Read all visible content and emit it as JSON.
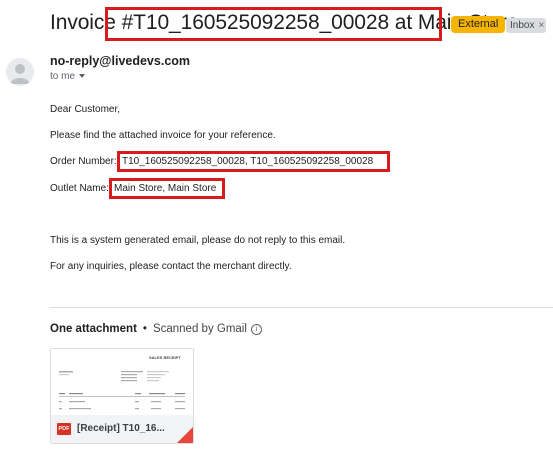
{
  "subject": "Invoice #T10_160525092258_00028 at Main Store",
  "labels": {
    "external": "External",
    "inbox": "Inbox",
    "inbox_close": "×"
  },
  "sender": {
    "email": "no-reply@livedevs.com",
    "to": "to me"
  },
  "body": {
    "greeting": "Dear Customer,",
    "intro": "Please find the attached invoice for your reference.",
    "order_label": "Order Number: ",
    "order_value": "T10_160525092258_00028, T10_160525092258_00028",
    "outlet_label": "Outlet Name: ",
    "outlet_value": "Main Store, Main Store",
    "disclaimer": "This is a system generated email, please do not reply to this email.",
    "contact": "For any inquiries, please contact the merchant directly."
  },
  "attachments": {
    "heading": "One attachment",
    "separator": "•",
    "scanned": "Scanned by Gmail",
    "info_icon": "i",
    "file": {
      "name": "[Receipt] T10_16...",
      "type_badge": "PDF"
    },
    "thumbnail_title": "SALES RECEIPT"
  },
  "colors": {
    "highlight": "#d81b1b",
    "external": "#f5b400",
    "pdf": "#d93025"
  }
}
